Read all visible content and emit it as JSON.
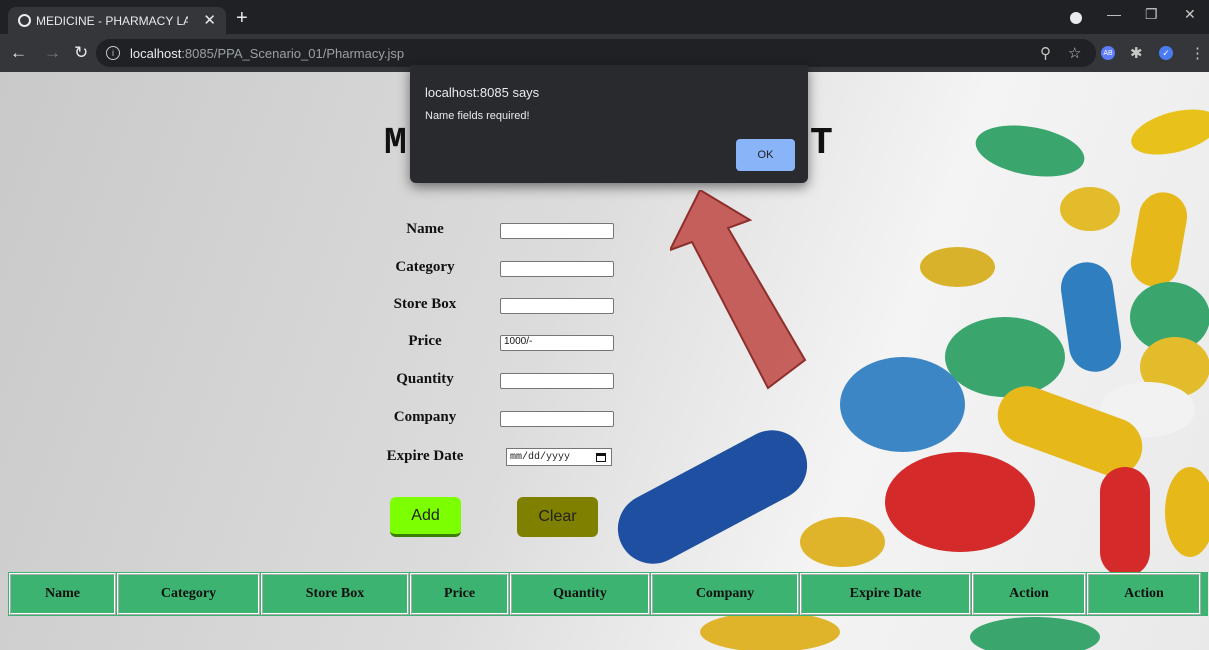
{
  "browser": {
    "tab_title": "MEDICINE - PHARMACY LANKA",
    "tab_close": "✕",
    "new_tab": "+",
    "url_host": "localhost",
    "url_path": ":8085/PPA_Scenario_01/Pharmacy.jsp",
    "ext_ab_label": "AB"
  },
  "page": {
    "title_start": "M",
    "title_end": "T"
  },
  "form": {
    "name_label": "Name",
    "category_label": "Category",
    "store_box_label": "Store Box",
    "price_label": "Price",
    "price_value": "1000/-",
    "quantity_label": "Quantity",
    "company_label": "Company",
    "expire_date_label": "Expire Date",
    "expire_date_placeholder": "mm/dd/yyyy",
    "add_label": "Add",
    "clear_label": "Clear"
  },
  "table": {
    "headers": [
      "Name",
      "Category",
      "Store Box",
      "Price",
      "Quantity",
      "Company",
      "Expire Date",
      "Action",
      "Action"
    ]
  },
  "dialog": {
    "title": "localhost:8085 says",
    "message": "Name fields required!",
    "ok_label": "OK"
  },
  "colors": {
    "table_header": "#3cb371",
    "add_button": "#7cff00",
    "clear_button": "#808000",
    "arrow": "#c0504d"
  }
}
